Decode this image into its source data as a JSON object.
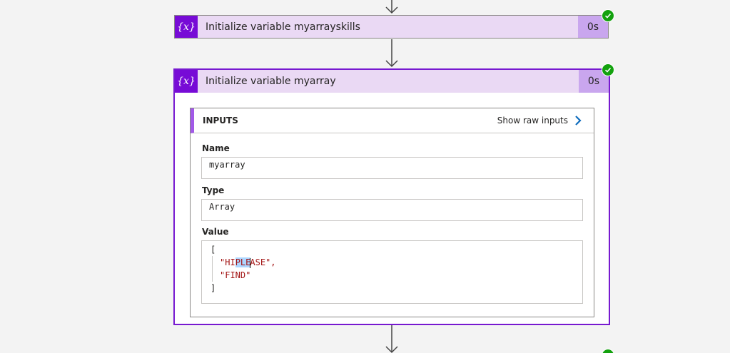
{
  "actions": [
    {
      "icon": "variable-icon",
      "icon_text": "{x}",
      "title": "Initialize variable myarrayskills",
      "duration": "0s",
      "status": "succeeded"
    },
    {
      "icon": "variable-icon",
      "icon_text": "{x}",
      "title": "Initialize variable myarray",
      "duration": "0s",
      "status": "succeeded",
      "expanded": true,
      "inputs": {
        "heading": "INPUTS",
        "show_raw_label": "Show raw inputs",
        "name_label": "Name",
        "name_value": "myarray",
        "type_label": "Type",
        "type_value": "Array",
        "value_label": "Value",
        "value_lines": {
          "open": "[",
          "item1_before": "\"HI",
          "item1_selected": "PLE",
          "item1_after": "ASE\",",
          "item2": "\"FIND\"",
          "close": "]"
        }
      }
    }
  ],
  "colors": {
    "variable_accent": "#770bd6",
    "header_bg": "#ead9f4",
    "duration_bg": "#c9a6ee",
    "success": "#13a10e",
    "selected_border": "#7719d0",
    "link_chevron": "#0f6cbd",
    "string_literal": "#a31515"
  }
}
